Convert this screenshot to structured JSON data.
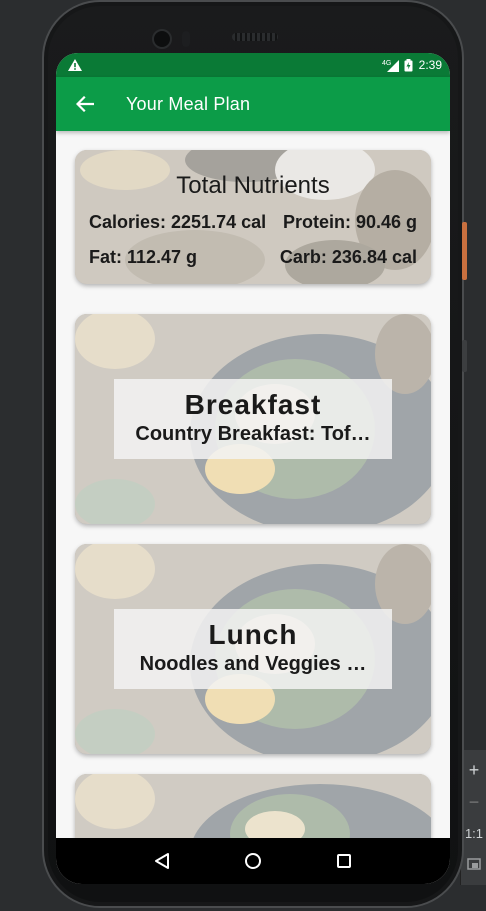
{
  "status_bar": {
    "time": "2:39",
    "network": "4G",
    "colors": {
      "bg": "#0a7a36"
    }
  },
  "app_bar": {
    "title": "Your Meal Plan",
    "colors": {
      "bg": "#0c9c48",
      "text": "#ffffff"
    }
  },
  "nutrients": {
    "title": "Total Nutrients",
    "calories": "Calories: 2251.74 cal",
    "protein": "Protein: 90.46 g",
    "fat": "Fat: 112.47 g",
    "carb": "Carb: 236.84 cal"
  },
  "meals": [
    {
      "type": "Breakfast",
      "name": "Country Breakfast: Tof…"
    },
    {
      "type": "Lunch",
      "name": "Noodles and Veggies …"
    }
  ],
  "emulator_panel": {
    "zoom_in": "+",
    "zoom_out": "−",
    "one_to_one": "1:1"
  },
  "icons": {
    "back": "arrow-back-icon",
    "warning": "warning-icon",
    "nav_back": "triangle-back-icon",
    "nav_home": "circle-home-icon",
    "nav_recents": "square-recents-icon"
  }
}
